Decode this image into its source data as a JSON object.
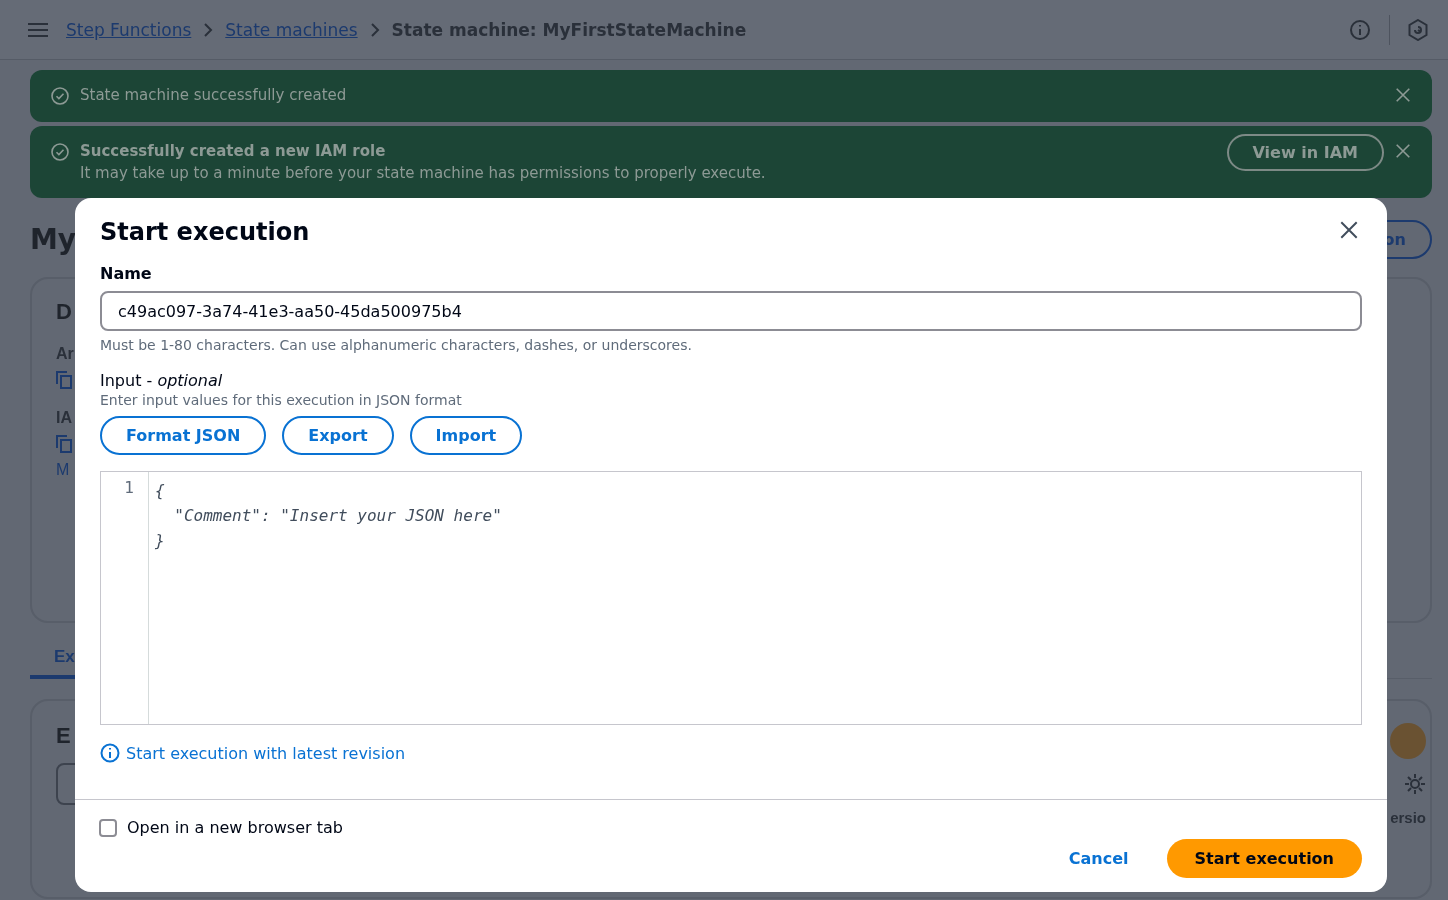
{
  "header": {
    "breadcrumbs": [
      {
        "label": "Step Functions",
        "kind": "link"
      },
      {
        "label": "State machines",
        "kind": "link"
      },
      {
        "label": "State machine: MyFirstStateMachine",
        "kind": "current"
      }
    ]
  },
  "notifications": [
    {
      "title": "State machine successfully created"
    },
    {
      "title": "Successfully created a new IAM role",
      "message": "It may take up to a minute before your state machine has permissions to properly execute.",
      "action": "View in IAM"
    }
  ],
  "background": {
    "heading": "My",
    "header_button": "on",
    "details_card": {
      "heading": "D",
      "labels": [
        "Ar",
        "IA"
      ],
      "link": "M"
    },
    "tab": {
      "label": "Ex",
      "selected": true
    },
    "executions_card": {
      "heading": "E",
      "column_label": "ersio"
    }
  },
  "modal": {
    "title": "Start execution",
    "name_field": {
      "label": "Name",
      "value": "c49ac097-3a74-41e3-aa50-45da500975b4",
      "hint": "Must be 1-80 characters. Can use alphanumeric characters, dashes, or underscores."
    },
    "input_section": {
      "label": "Input - *optional*",
      "description": "Enter input values for this execution in JSON format",
      "buttons": [
        "Format JSON",
        "Export",
        "Import"
      ],
      "editor": {
        "line_numbers": [
          "1"
        ],
        "lines": [
          "{",
          "  \"Comment\": \"Insert your JSON here\"",
          "}"
        ]
      }
    },
    "info_link": "Start execution with latest revision",
    "open_in_new_tab": {
      "label": "Open in a new browser tab",
      "checked": false
    },
    "buttons": [
      {
        "label": "Cancel",
        "kind": "link"
      },
      {
        "label": "Start execution",
        "kind": "primary"
      }
    ]
  }
}
